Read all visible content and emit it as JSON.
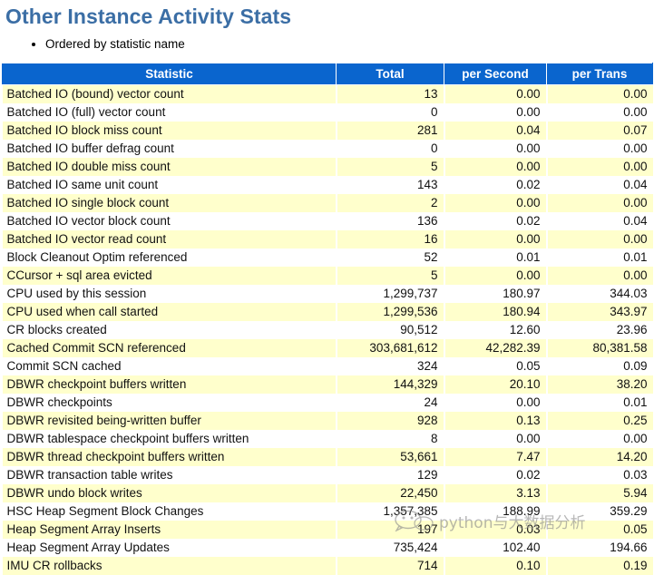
{
  "page": {
    "title": "Other Instance Activity Stats",
    "notes": [
      "Ordered by statistic name"
    ],
    "title_color": "#3b6ea5",
    "header_bg_color": "#0a65ce",
    "row_alt_color": "#ffffcc"
  },
  "watermark": {
    "text": "python与大数据分析",
    "logo_name": "wechat-logo"
  },
  "table": {
    "columns": [
      "Statistic",
      "Total",
      "per Second",
      "per Trans"
    ],
    "rows": [
      {
        "statistic": "Batched IO (bound) vector count",
        "total": "13",
        "per_second": "0.00",
        "per_trans": "0.00"
      },
      {
        "statistic": "Batched IO (full) vector count",
        "total": "0",
        "per_second": "0.00",
        "per_trans": "0.00"
      },
      {
        "statistic": "Batched IO block miss count",
        "total": "281",
        "per_second": "0.04",
        "per_trans": "0.07"
      },
      {
        "statistic": "Batched IO buffer defrag count",
        "total": "0",
        "per_second": "0.00",
        "per_trans": "0.00"
      },
      {
        "statistic": "Batched IO double miss count",
        "total": "5",
        "per_second": "0.00",
        "per_trans": "0.00"
      },
      {
        "statistic": "Batched IO same unit count",
        "total": "143",
        "per_second": "0.02",
        "per_trans": "0.04"
      },
      {
        "statistic": "Batched IO single block count",
        "total": "2",
        "per_second": "0.00",
        "per_trans": "0.00"
      },
      {
        "statistic": "Batched IO vector block count",
        "total": "136",
        "per_second": "0.02",
        "per_trans": "0.04"
      },
      {
        "statistic": "Batched IO vector read count",
        "total": "16",
        "per_second": "0.00",
        "per_trans": "0.00"
      },
      {
        "statistic": "Block Cleanout Optim referenced",
        "total": "52",
        "per_second": "0.01",
        "per_trans": "0.01"
      },
      {
        "statistic": "CCursor + sql area evicted",
        "total": "5",
        "per_second": "0.00",
        "per_trans": "0.00"
      },
      {
        "statistic": "CPU used by this session",
        "total": "1,299,737",
        "per_second": "180.97",
        "per_trans": "344.03"
      },
      {
        "statistic": "CPU used when call started",
        "total": "1,299,536",
        "per_second": "180.94",
        "per_trans": "343.97"
      },
      {
        "statistic": "CR blocks created",
        "total": "90,512",
        "per_second": "12.60",
        "per_trans": "23.96"
      },
      {
        "statistic": "Cached Commit SCN referenced",
        "total": "303,681,612",
        "per_second": "42,282.39",
        "per_trans": "80,381.58"
      },
      {
        "statistic": "Commit SCN cached",
        "total": "324",
        "per_second": "0.05",
        "per_trans": "0.09"
      },
      {
        "statistic": "DBWR checkpoint buffers written",
        "total": "144,329",
        "per_second": "20.10",
        "per_trans": "38.20"
      },
      {
        "statistic": "DBWR checkpoints",
        "total": "24",
        "per_second": "0.00",
        "per_trans": "0.01"
      },
      {
        "statistic": "DBWR revisited being-written buffer",
        "total": "928",
        "per_second": "0.13",
        "per_trans": "0.25"
      },
      {
        "statistic": "DBWR tablespace checkpoint buffers written",
        "total": "8",
        "per_second": "0.00",
        "per_trans": "0.00"
      },
      {
        "statistic": "DBWR thread checkpoint buffers written",
        "total": "53,661",
        "per_second": "7.47",
        "per_trans": "14.20"
      },
      {
        "statistic": "DBWR transaction table writes",
        "total": "129",
        "per_second": "0.02",
        "per_trans": "0.03"
      },
      {
        "statistic": "DBWR undo block writes",
        "total": "22,450",
        "per_second": "3.13",
        "per_trans": "5.94"
      },
      {
        "statistic": "HSC Heap Segment Block Changes",
        "total": "1,357,385",
        "per_second": "188.99",
        "per_trans": "359.29"
      },
      {
        "statistic": "Heap Segment Array Inserts",
        "total": "197",
        "per_second": "0.03",
        "per_trans": "0.05"
      },
      {
        "statistic": "Heap Segment Array Updates",
        "total": "735,424",
        "per_second": "102.40",
        "per_trans": "194.66"
      },
      {
        "statistic": "IMU CR rollbacks",
        "total": "714",
        "per_second": "0.10",
        "per_trans": "0.19"
      }
    ]
  }
}
